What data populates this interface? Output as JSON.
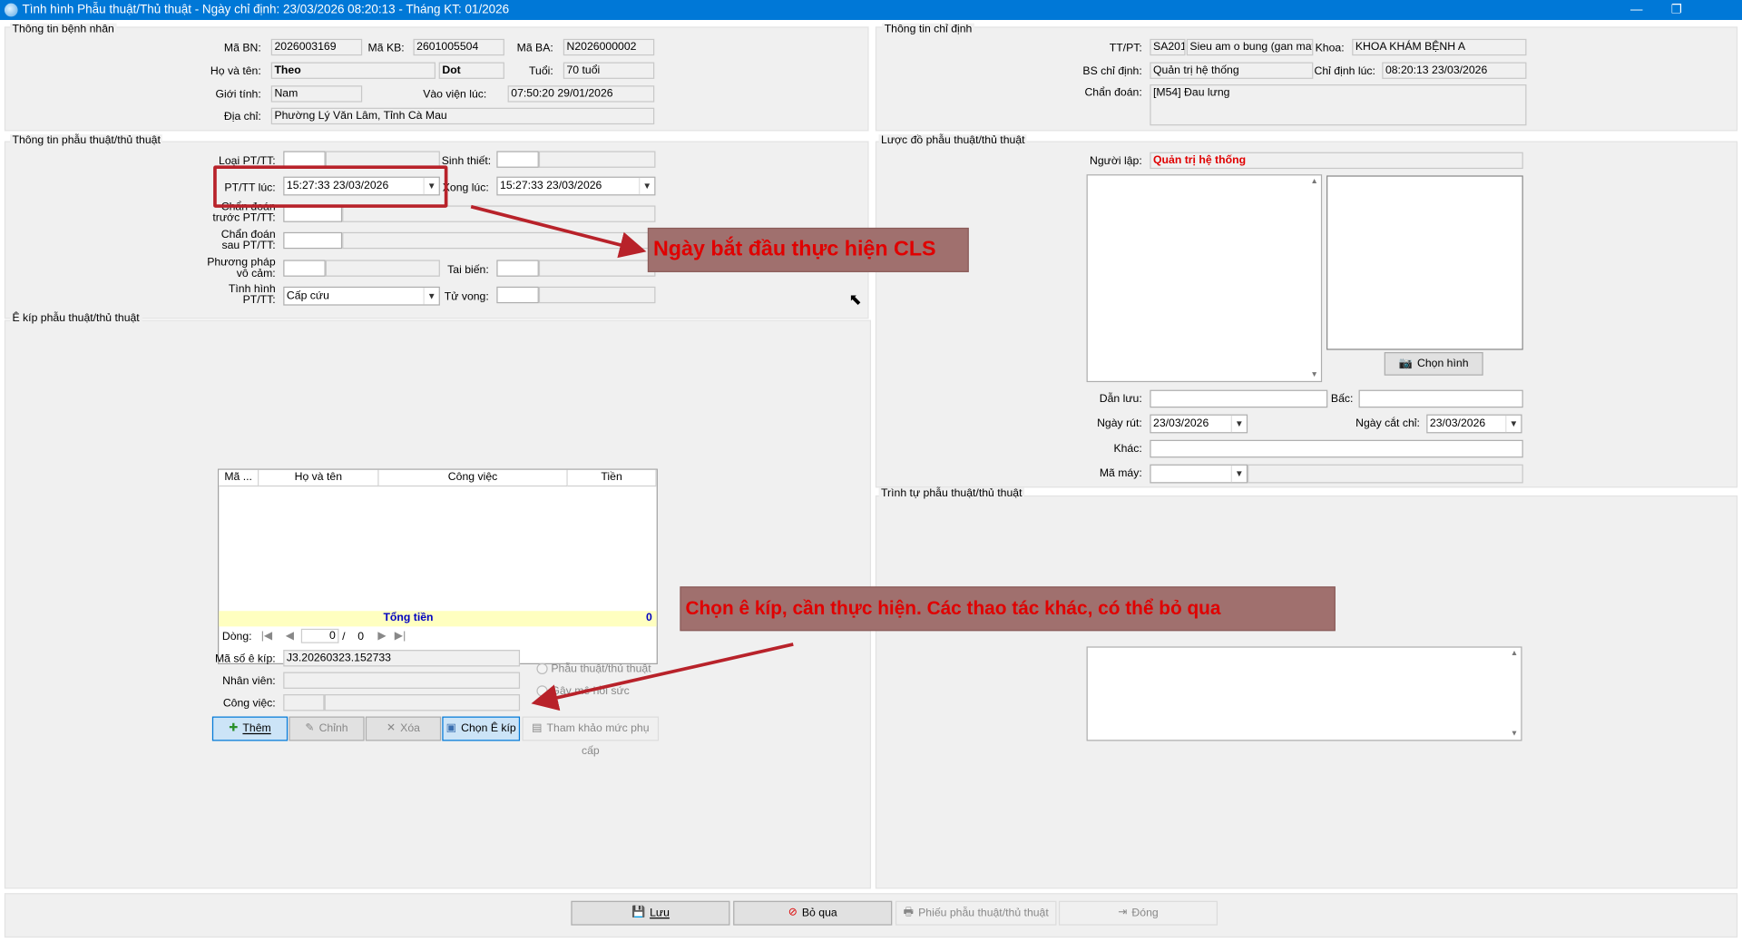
{
  "window": {
    "title": "Tình hình Phẫu thuật/Thủ thuật - Ngày chỉ định: 23/03/2026 08:20:13 - Tháng KT: 01/2026",
    "minimize": "—",
    "restore": "❐"
  },
  "patient": {
    "group_title": "Thông tin bệnh nhân",
    "ma_bn_label": "Mã BN:",
    "ma_bn": "2026003169",
    "ma_kb_label": "Mã KB:",
    "ma_kb": "2601005504",
    "ma_ba_label": "Mã BA:",
    "ma_ba": "N2026000002",
    "ho_ten_label": "Họ và tên:",
    "ho": "Theo",
    "ten": "Dot",
    "tuoi_label": "Tuổi:",
    "tuoi": "70 tuổi",
    "gioi_tinh_label": "Giới tính:",
    "gioi_tinh": "Nam",
    "vao_vien_label": "Vào viện lúc:",
    "vao_vien": "07:50:20 29/01/2026",
    "dia_chi_label": "Địa chỉ:",
    "dia_chi": "Phường Lý Văn Lâm, Tỉnh Cà Mau"
  },
  "order": {
    "group_title": "Thông tin chỉ định",
    "tt_pt_label": "TT/PT:",
    "tt_pt_code": "SA201",
    "tt_pt_name": "Sieu am o bung (gan mat, tụ",
    "khoa_label": "Khoa:",
    "khoa": "KHOA KHÁM BỆNH A",
    "bs_label": "BS chỉ định:",
    "bs": "Quản trị hệ thống",
    "chi_dinh_luc_label": "Chỉ định lúc:",
    "chi_dinh_luc": "08:20:13 23/03/2026",
    "chan_doan_label": "Chẩn đoán:",
    "chan_doan": "[M54] Đau lưng"
  },
  "surgery": {
    "group_title": "Thông tin phẫu thuật/thủ thuật",
    "loai_label": "Loại PT/TT:",
    "sinh_thiet_label": "Sinh thiết:",
    "pttt_luc_label": "PT/TT lúc:",
    "pttt_luc": "15:27:33 23/03/2026",
    "xong_luc_label": "Xong lúc:",
    "xong_luc": "15:27:33 23/03/2026",
    "cd_truoc_label_1": "Chẩn đoán",
    "cd_truoc_label_2": "trước PT/TT:",
    "cd_sau_label_1": "Chẩn đoán",
    "cd_sau_label_2": "sau PT/TT:",
    "vo_cam_label_1": "Phương pháp",
    "vo_cam_label_2": "vô cảm:",
    "tai_bien_label": "Tai biến:",
    "tinh_hinh_label_1": "Tình hình",
    "tinh_hinh_label_2": "PT/TT:",
    "tinh_hinh": "Cấp cứu",
    "tu_vong_label": "Tử vong:"
  },
  "team": {
    "group_title": "Ê kíp phẫu thuật/thủ thuật",
    "columns": [
      "Mã ...",
      "Họ và tên",
      "Công việc",
      "Tiền"
    ],
    "total_label": "Tổng tiền",
    "total_value": "0",
    "dong_label": "Dòng:",
    "page_current": "0",
    "page_sep": "/",
    "page_total": "0",
    "ma_so_label": "Mã số ê kíp:",
    "ma_so": "J3.20260323.152733",
    "nhan_vien_label": "Nhân viên:",
    "cong_viec_label": "Công việc:",
    "radio_1": "Phẫu thuật/thủ thuật",
    "radio_2": "Gây mê hồi sức",
    "btn_them": "Thêm",
    "btn_chinh": "Chỉnh",
    "btn_xoa": "Xóa",
    "btn_chon": "Chọn Ê kíp",
    "btn_tham_khao": "Tham khảo mức phụ cấp"
  },
  "diagram": {
    "group_title": "Lược đồ phẫu thuật/thủ thuật",
    "nguoi_lap_label": "Người lập:",
    "nguoi_lap": "Quản trị hệ thống",
    "chon_hinh": "Chọn hình",
    "dan_luu_label": "Dẫn lưu:",
    "bac_label": "Bấc:",
    "ngay_rut_label": "Ngày rút:",
    "ngay_rut": "23/03/2026",
    "ngay_cat_chi_label": "Ngày cắt chỉ:",
    "ngay_cat_chi": "23/03/2026",
    "khac_label": "Khác:",
    "ma_may_label": "Mã máy:"
  },
  "sequence": {
    "group_title": "Trình tự phẫu thuật/thủ thuật"
  },
  "footer": {
    "luu": "Lưu",
    "bo_qua": "Bỏ qua",
    "phieu": "Phiếu phẫu thuật/thủ thuật",
    "dong": "Đóng"
  },
  "annotations": {
    "callout_1": "Ngày bắt đầu thực hiện CLS",
    "callout_2": "Chọn ê kíp, cần thực hiện. Các thao tác khác, có thể bỏ qua"
  },
  "colors": {
    "titlebar": "#0078d7",
    "callout_bg": "#a0706e",
    "callout_text": "#e00000",
    "highlight": "#b8222a"
  }
}
